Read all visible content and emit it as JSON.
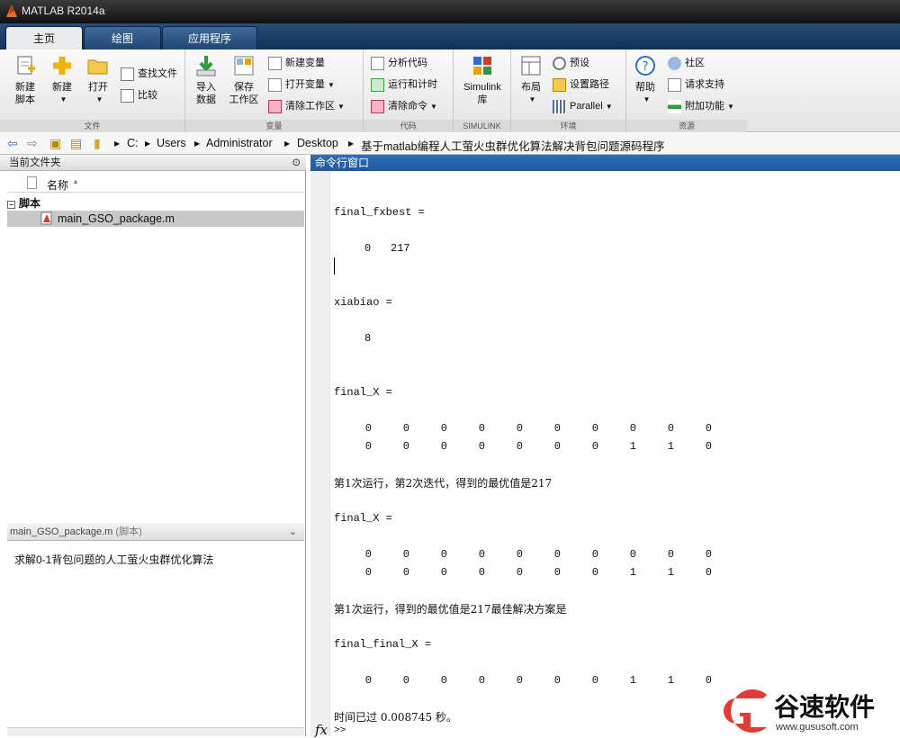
{
  "window": {
    "title": "MATLAB R2014a"
  },
  "tabs": [
    {
      "label": "主页"
    },
    {
      "label": "绘图"
    },
    {
      "label": "应用程序"
    }
  ],
  "ribbon": {
    "file": {
      "section": "文件",
      "new_script_l1": "新建",
      "new_script_l2": "脚本",
      "new_l1": "新建",
      "open_l1": "打开",
      "find_files": "查找文件",
      "compare": "比较"
    },
    "variable": {
      "section": "变量",
      "import_l1": "导入",
      "import_l2": "数据",
      "save_l1": "保存",
      "save_l2": "工作区",
      "new_var": "新建变量",
      "open_var": "打开变量",
      "clear_ws": "清除工作区"
    },
    "code": {
      "section": "代码",
      "analyze": "分析代码",
      "run_time": "运行和计时",
      "clear_cmds": "清除命令"
    },
    "simulink": {
      "section": "SIMULINK",
      "label_l1": "Simulink",
      "label_l2": "库"
    },
    "env": {
      "section": "环境",
      "layout": "布局",
      "prefs": "预设",
      "set_path": "设置路径",
      "parallel": "Parallel"
    },
    "res": {
      "section": "资源",
      "help": "帮助",
      "community": "社区",
      "support": "请求支持",
      "addons": "附加功能"
    }
  },
  "address": {
    "crumbs": [
      "C:",
      "Users",
      "Administrator",
      "Desktop",
      "基于matlab编程人工萤火虫群优化算法解决背包问题源码程序"
    ]
  },
  "current_folder": {
    "title": "当前文件夹",
    "col_name": "名称",
    "group": "脚本",
    "file": "main_GSO_package.m",
    "detail_title": "main_GSO_package.m",
    "detail_type": "(脚本)",
    "detail_text": "求解0-1背包问题的人工萤火虫群优化算法"
  },
  "command_window": {
    "title": "命令行窗口",
    "fxbest_label": "final_fxbest =",
    "fxbest_values": [
      "0",
      "217"
    ],
    "xiabiao_label": "xiabiao =",
    "xiabiao_value": "8",
    "final_x_label": "final_X =",
    "matrix1": [
      [
        "0",
        "0",
        "0",
        "0",
        "0",
        "0",
        "0",
        "0",
        "0",
        "0"
      ],
      [
        "0",
        "0",
        "0",
        "0",
        "0",
        "0",
        "0",
        "1",
        "1",
        "0"
      ]
    ],
    "msg1": "第1次运行，第2次迭代，得到的最优值是217",
    "final_x_label2": "final_X =",
    "matrix2": [
      [
        "0",
        "0",
        "0",
        "0",
        "0",
        "0",
        "0",
        "0",
        "0",
        "0"
      ],
      [
        "0",
        "0",
        "0",
        "0",
        "0",
        "0",
        "0",
        "1",
        "1",
        "0"
      ]
    ],
    "msg2": "第1次运行，得到的最优值是217最佳解决方案是",
    "final_final_label": "final_final_X =",
    "matrix3": [
      [
        "0",
        "0",
        "0",
        "0",
        "0",
        "0",
        "0",
        "1",
        "1",
        "0"
      ]
    ],
    "elapsed": "时间已过 0.008745 秒。",
    "prompt": ">>",
    "fx": "fx"
  },
  "watermark": {
    "brand": "谷速软件",
    "url": "www.gususoft.com"
  }
}
